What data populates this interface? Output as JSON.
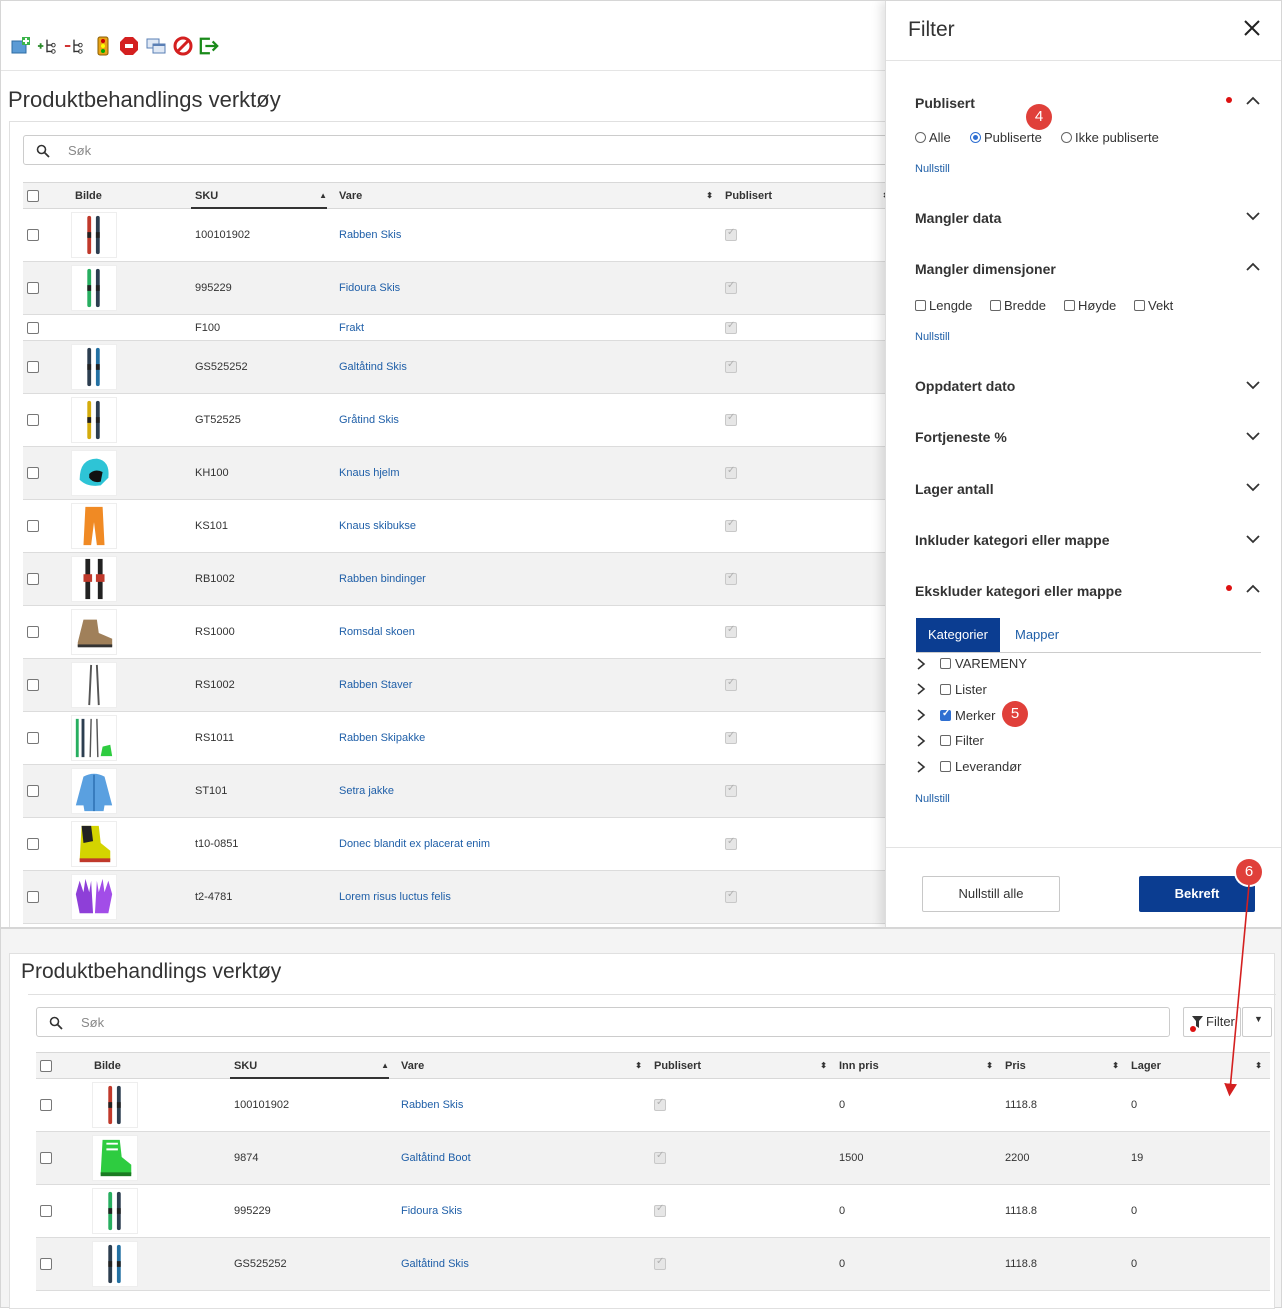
{
  "page_title": "Produktbehandlings verktøy",
  "search_placeholder": "Søk",
  "columns": {
    "bilde": "Bilde",
    "sku": "SKU",
    "vare": "Vare",
    "publisert": "Publisert",
    "inn_pris": "Inn pris",
    "pris": "Pris",
    "lager": "Lager"
  },
  "toolbar_icons": [
    "add-product-icon",
    "add-tree-node-icon",
    "remove-tree-node-icon",
    "traffic-light-icon",
    "stop-icon",
    "copy-windows-icon",
    "block-icon",
    "exit-icon"
  ],
  "top_rows": [
    {
      "sku": "100101902",
      "vare": "Rabben Skis",
      "img": "ski-red"
    },
    {
      "sku": "995229",
      "vare": "Fidoura Skis",
      "img": "ski-green"
    },
    {
      "sku": "F100",
      "vare": "Frakt",
      "img": "none"
    },
    {
      "sku": "GS525252",
      "vare": "Galtåtind Skis",
      "img": "ski-blue"
    },
    {
      "sku": "GT52525",
      "vare": "Gråtind Skis",
      "img": "ski-yellow"
    },
    {
      "sku": "KH100",
      "vare": "Knaus hjelm",
      "img": "helmet"
    },
    {
      "sku": "KS101",
      "vare": "Knaus skibukse",
      "img": "pants"
    },
    {
      "sku": "RB1002",
      "vare": "Rabben bindinger",
      "img": "bindings"
    },
    {
      "sku": "RS1000",
      "vare": "Romsdal skoen",
      "img": "shoe"
    },
    {
      "sku": "RS1002",
      "vare": "Rabben Staver",
      "img": "poles"
    },
    {
      "sku": "RS1011",
      "vare": "Rabben Skipakke",
      "img": "skipack"
    },
    {
      "sku": "ST101",
      "vare": "Setra jakke",
      "img": "jacket"
    },
    {
      "sku": "t10-0851",
      "vare": "Donec blandit ex placerat enim",
      "img": "boot"
    },
    {
      "sku": "t2-4781",
      "vare": "Lorem risus luctus felis",
      "img": "gloves"
    }
  ],
  "filter": {
    "title": "Filter",
    "sections": {
      "publisert": "Publisert",
      "mangler_data": "Mangler data",
      "mangler_dimensjoner": "Mangler dimensjoner",
      "oppdatert_dato": "Oppdatert dato",
      "fortjeneste": "Fortjeneste %",
      "lager_antall": "Lager antall",
      "inkluder": "Inkluder kategori eller mappe",
      "ekskluder": "Ekskluder kategori eller mappe"
    },
    "publisert_options": [
      "Alle",
      "Publiserte",
      "Ikke publiserte"
    ],
    "publisert_selected": "Publiserte",
    "dimension_options": [
      "Lengde",
      "Bredde",
      "Høyde",
      "Vekt"
    ],
    "reset_link": "Nullstill",
    "tabs": [
      "Kategorier",
      "Mapper"
    ],
    "tree": [
      {
        "label": "VAREMENY",
        "checked": false
      },
      {
        "label": "Lister",
        "checked": false
      },
      {
        "label": "Merker",
        "checked": true
      },
      {
        "label": "Filter",
        "checked": false
      },
      {
        "label": "Leverandør",
        "checked": false
      }
    ],
    "reset_all": "Nullstill alle",
    "confirm": "Bekreft"
  },
  "badges": [
    "4",
    "5",
    "6"
  ],
  "bottom": {
    "filter_button": "Filter",
    "rows": [
      {
        "sku": "100101902",
        "vare": "Rabben Skis",
        "inn_pris": "0",
        "pris": "1118.8",
        "lager": "0",
        "img": "ski-red"
      },
      {
        "sku": "9874",
        "vare": "Galtåtind Boot",
        "inn_pris": "1500",
        "pris": "2200",
        "lager": "19",
        "img": "green-boot"
      },
      {
        "sku": "995229",
        "vare": "Fidoura Skis",
        "inn_pris": "0",
        "pris": "1118.8",
        "lager": "0",
        "img": "ski-green"
      },
      {
        "sku": "GS525252",
        "vare": "Galtåtind Skis",
        "inn_pris": "0",
        "pris": "1118.8",
        "lager": "0",
        "img": "ski-blue"
      }
    ]
  },
  "colors": {
    "primary": "#0b3d91",
    "link": "#1f5fa8",
    "badge": "#e0403a",
    "dot": "#dd1111"
  }
}
